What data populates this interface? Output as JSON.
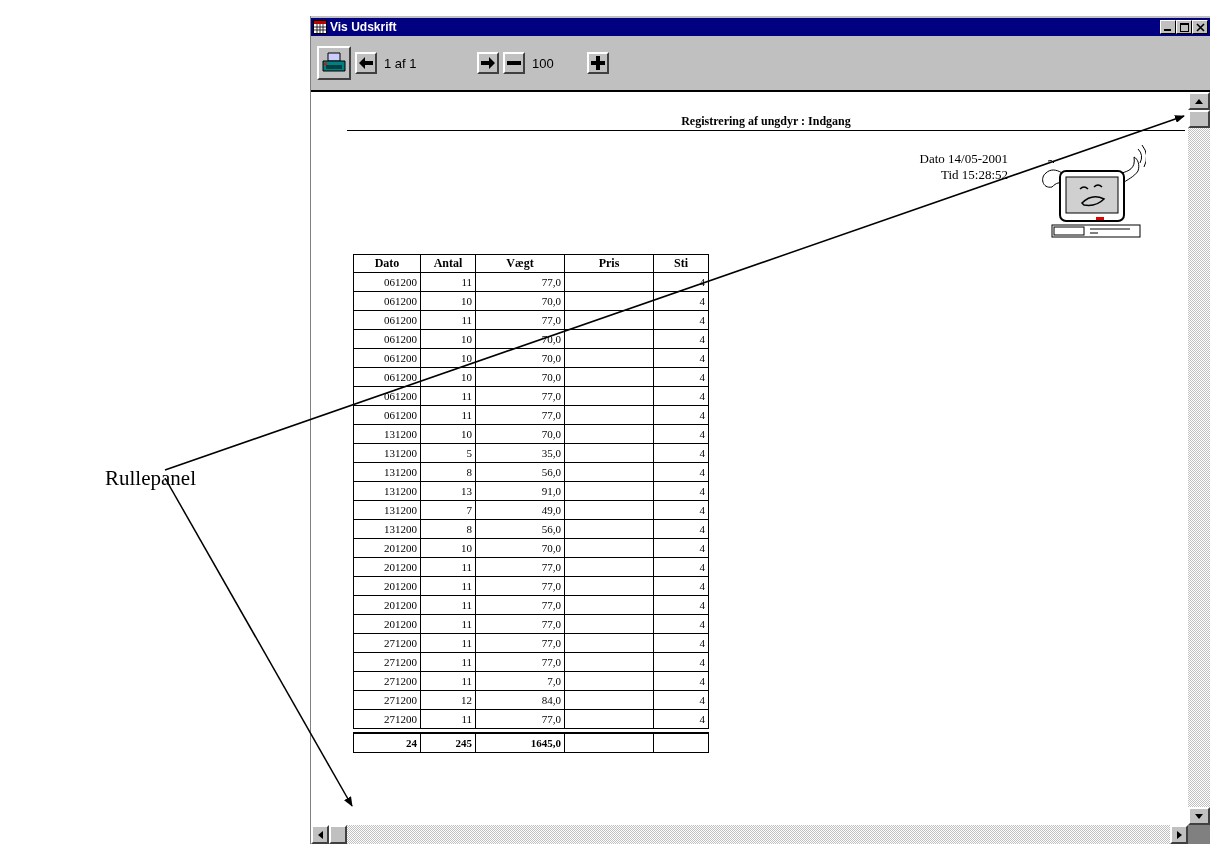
{
  "annotation": {
    "label": "Rullepanel"
  },
  "window": {
    "title": "Vis Udskrift"
  },
  "toolbar": {
    "page_field": "1 af 1",
    "zoom_field": "100"
  },
  "report": {
    "title": "Registrering af ungdyr : Indgang",
    "date": "Dato 14/05-2001",
    "time": "Tid  15:28:52",
    "table": {
      "columns": [
        "Dato",
        "Antal",
        "Vægt",
        "Pris",
        "Sti"
      ],
      "rows": [
        {
          "dato": "061200",
          "antal": "11",
          "vaegt": "77,0",
          "sti": "4"
        },
        {
          "dato": "061200",
          "antal": "10",
          "vaegt": "70,0",
          "sti": "4"
        },
        {
          "dato": "061200",
          "antal": "11",
          "vaegt": "77,0",
          "sti": "4"
        },
        {
          "dato": "061200",
          "antal": "10",
          "vaegt": "70,0",
          "sti": "4"
        },
        {
          "dato": "061200",
          "antal": "10",
          "vaegt": "70,0",
          "sti": "4"
        },
        {
          "dato": "061200",
          "antal": "10",
          "vaegt": "70,0",
          "sti": "4"
        },
        {
          "dato": "061200",
          "antal": "11",
          "vaegt": "77,0",
          "sti": "4"
        },
        {
          "dato": "061200",
          "antal": "11",
          "vaegt": "77,0",
          "sti": "4"
        },
        {
          "dato": "131200",
          "antal": "10",
          "vaegt": "70,0",
          "sti": "4"
        },
        {
          "dato": "131200",
          "antal": "5",
          "vaegt": "35,0",
          "sti": "4"
        },
        {
          "dato": "131200",
          "antal": "8",
          "vaegt": "56,0",
          "sti": "4"
        },
        {
          "dato": "131200",
          "antal": "13",
          "vaegt": "91,0",
          "sti": "4"
        },
        {
          "dato": "131200",
          "antal": "7",
          "vaegt": "49,0",
          "sti": "4"
        },
        {
          "dato": "131200",
          "antal": "8",
          "vaegt": "56,0",
          "sti": "4"
        },
        {
          "dato": "201200",
          "antal": "10",
          "vaegt": "70,0",
          "sti": "4"
        },
        {
          "dato": "201200",
          "antal": "11",
          "vaegt": "77,0",
          "sti": "4"
        },
        {
          "dato": "201200",
          "antal": "11",
          "vaegt": "77,0",
          "sti": "4"
        },
        {
          "dato": "201200",
          "antal": "11",
          "vaegt": "77,0",
          "sti": "4"
        },
        {
          "dato": "201200",
          "antal": "11",
          "vaegt": "77,0",
          "sti": "4"
        },
        {
          "dato": "271200",
          "antal": "11",
          "vaegt": "77,0",
          "sti": "4"
        },
        {
          "dato": "271200",
          "antal": "11",
          "vaegt": "77,0",
          "sti": "4"
        },
        {
          "dato": "271200",
          "antal": "11",
          "vaegt": "7,0",
          "sti": "4"
        },
        {
          "dato": "271200",
          "antal": "12",
          "vaegt": "84,0",
          "sti": "4"
        },
        {
          "dato": "271200",
          "antal": "11",
          "vaegt": "77,0",
          "sti": "4"
        }
      ],
      "totals": {
        "dato": "24",
        "antal": "245",
        "vaegt": "1645,0"
      }
    }
  }
}
